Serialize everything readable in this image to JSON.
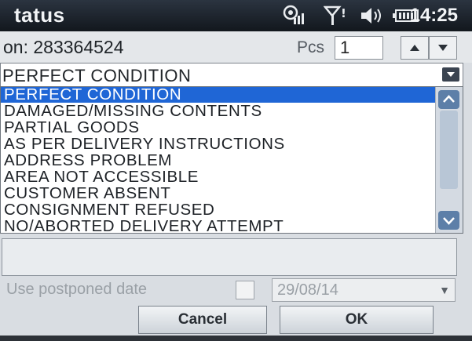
{
  "status_bar": {
    "title": "tatus",
    "time": "14:25",
    "icons": [
      "connectivity-icon",
      "signal-icon",
      "volume-icon",
      "battery-icon"
    ]
  },
  "consignment": {
    "text": "on: 283364524",
    "pcs_label": "Pcs",
    "pcs_value": "1"
  },
  "condition_dropdown": {
    "selected": "PERFECT CONDITION"
  },
  "condition_list": {
    "items": [
      "PERFECT CONDITION",
      "DAMAGED/MISSING CONTENTS",
      "PARTIAL GOODS",
      "AS PER DELIVERY INSTRUCTIONS",
      "ADDRESS PROBLEM",
      "AREA NOT ACCESSIBLE",
      "CUSTOMER ABSENT",
      "CONSIGNMENT REFUSED",
      "NO/ABORTED DELIVERY ATTEMPT"
    ],
    "selected_index": 0
  },
  "postponed": {
    "label": "Use postponed date",
    "date": "29/08/14"
  },
  "buttons": {
    "cancel": "Cancel",
    "ok": "OK"
  },
  "colors": {
    "selection": "#1f66d6",
    "scroll_button": "#5d7fa8"
  }
}
